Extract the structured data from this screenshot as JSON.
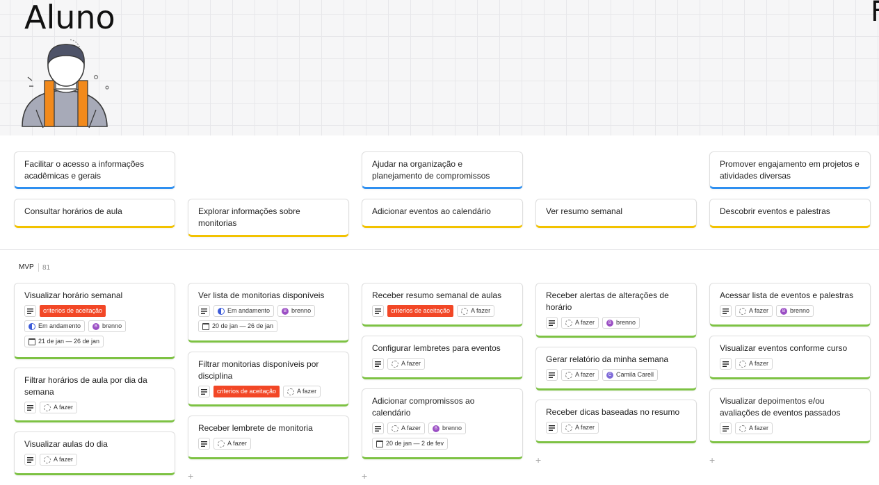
{
  "persona": {
    "title": "Aluno",
    "next_column_title": "F"
  },
  "swimlane": {
    "label": "MVP",
    "count": "81"
  },
  "goals": [
    {
      "text": "Facilitar o acesso a informações acadêmicas e gerais"
    },
    {
      "text": "Ajudar na organização e planejamento de compromissos"
    },
    {
      "text": "Promover engajamento em projetos e atividades diversas"
    }
  ],
  "activities": [
    {
      "text": "Consultar horários de aula"
    },
    {
      "text": "Explorar informações sobre monitorias"
    },
    {
      "text": "Adicionar eventos ao calendário"
    },
    {
      "text": "Ver resumo semanal"
    },
    {
      "text": "Descobrir eventos e palestras"
    }
  ],
  "stories": {
    "c1": [
      {
        "title": "Visualizar horário semanal",
        "tag": "criterios de aceitação",
        "status": "Em andamento",
        "assignee": "brenno",
        "assignee_initial": "B",
        "dates": "21 de jan — 26 de jan"
      },
      {
        "title": "Filtrar horários de aula por dia da semana",
        "status": "A fazer"
      },
      {
        "title": "Visualizar aulas do dia",
        "status": "A fazer"
      }
    ],
    "c2": [
      {
        "title": "Ver lista de monitorias disponíveis",
        "status": "Em andamento",
        "assignee": "brenno",
        "assignee_initial": "B",
        "dates": "20 de jan — 26 de jan"
      },
      {
        "title": "Filtrar monitorias disponíveis por disciplina",
        "tag": "criterios de aceitação",
        "status": "A fazer"
      },
      {
        "title": "Receber lembrete de monitoria",
        "status": "A fazer"
      }
    ],
    "c3": [
      {
        "title": "Receber resumo semanal de aulas",
        "tag": "criterios de aceitação",
        "status": "A fazer"
      },
      {
        "title": "Configurar lembretes para eventos",
        "status": "A fazer"
      },
      {
        "title": "Adicionar compromissos ao calendário",
        "status": "A fazer",
        "assignee": "brenno",
        "assignee_initial": "B",
        "dates": "20 de jan — 2 de fev"
      }
    ],
    "c4": [
      {
        "title": "Receber alertas de alterações de horário",
        "status": "A fazer",
        "assignee": "brenno",
        "assignee_initial": "B"
      },
      {
        "title": "Gerar relatório da minha semana",
        "status": "A fazer",
        "assignee": "Camila Carell",
        "assignee_initial": "C"
      },
      {
        "title": "Receber dicas baseadas no resumo",
        "status": "A fazer"
      }
    ],
    "c5": [
      {
        "title": "Acessar lista de eventos e palestras",
        "status": "A fazer",
        "assignee": "brenno",
        "assignee_initial": "B"
      },
      {
        "title": "Visualizar eventos conforme curso",
        "status": "A fazer"
      },
      {
        "title": "Visualizar depoimentos e/ou avaliações de eventos passados",
        "status": "A fazer"
      }
    ]
  },
  "add_symbol": "+",
  "colors": {
    "goal": "#2e8ff0",
    "activity": "#f2c200",
    "story": "#7dc243",
    "tag": "#f24726",
    "assignee": "#9b4fc4"
  }
}
